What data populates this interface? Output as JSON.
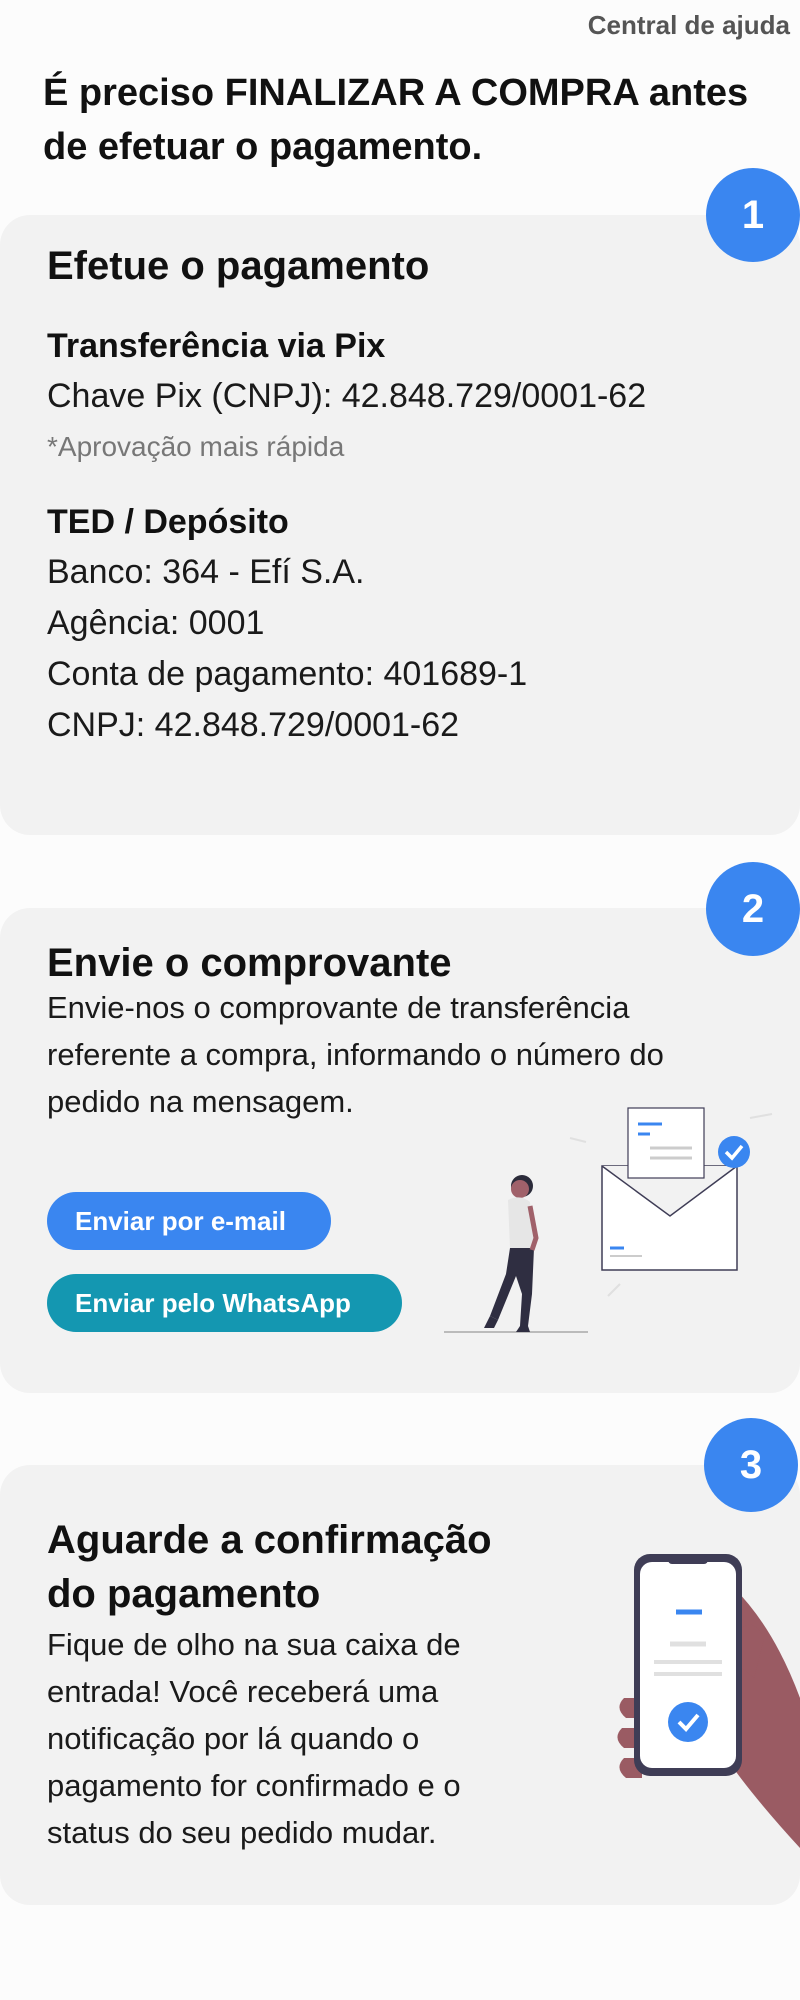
{
  "header": {
    "help_link": "Central de ajuda"
  },
  "headline": "É preciso FINALIZAR A COMPRA antes de efetuar o pagamento.",
  "steps": [
    {
      "number": "1",
      "title": "Efetue o pagamento",
      "pix": {
        "heading": "Transferência via Pix",
        "key_line": "Chave Pix (CNPJ): 42.848.729/0001-62",
        "note": "*Aprovação mais rápida"
      },
      "ted": {
        "heading": "TED / Depósito",
        "lines": [
          "Banco: 364 - Efí S.A.",
          "Agência: 0001",
          "Conta de pagamento: 401689-1",
          "CNPJ: 42.848.729/0001-62"
        ]
      }
    },
    {
      "number": "2",
      "title": "Envie o comprovante",
      "description": "Envie-nos o comprovante de transferência referente a compra, informando o número do pedido na mensagem.",
      "buttons": {
        "email": "Enviar por e-mail",
        "whatsapp": "Enviar pelo WhatsApp"
      }
    },
    {
      "number": "3",
      "title": "Aguarde a confirmação do pagamento",
      "description": "Fique de olho na sua caixa de entrada! Você receberá uma notificação por lá quando o pagamento for confirmado e o status do seu pedido mudar."
    }
  ],
  "colors": {
    "accent_blue": "#3a86f0",
    "whatsapp_teal": "#1497b1",
    "card_bg": "#f2f2f2"
  },
  "illustrations": {
    "step2": "person-walking-with-envelope-icon",
    "step3": "hand-holding-phone-icon"
  }
}
